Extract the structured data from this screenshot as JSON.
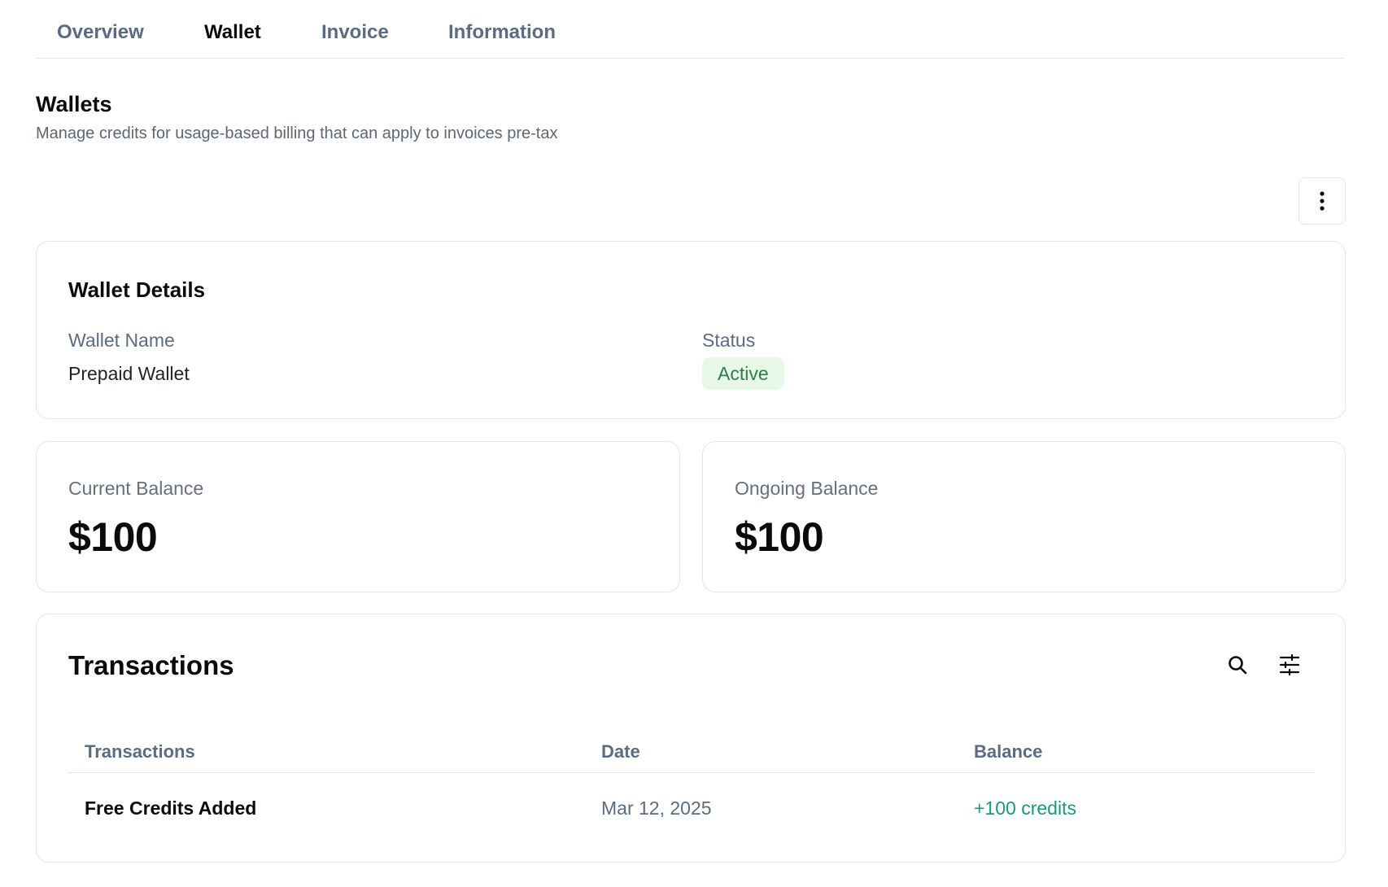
{
  "tabs": [
    {
      "label": "Overview"
    },
    {
      "label": "Wallet"
    },
    {
      "label": "Invoice"
    },
    {
      "label": "Information"
    }
  ],
  "header": {
    "title": "Wallets",
    "subtitle": "Manage credits for usage-based billing that can apply to invoices pre-tax"
  },
  "more_icon": "vertical-dots-icon",
  "details": {
    "title": "Wallet Details",
    "wallet_name_label": "Wallet Name",
    "wallet_name": "Prepaid Wallet",
    "status_label": "Status",
    "status": "Active"
  },
  "balances": {
    "current_label": "Current Balance",
    "current_value": "$100",
    "ongoing_label": "Ongoing Balance",
    "ongoing_value": "$100"
  },
  "transactions": {
    "title": "Transactions",
    "columns": [
      "Transactions",
      "Date",
      "Balance"
    ],
    "rows": [
      {
        "name": "Free Credits Added",
        "date": "Mar 12, 2025",
        "balance": "+100 credits"
      }
    ]
  },
  "colors": {
    "accent_green": "#1a9a78",
    "status_bg": "#e8f8e8",
    "status_text": "#2e7d4a",
    "muted_text": "#5b6b82"
  }
}
